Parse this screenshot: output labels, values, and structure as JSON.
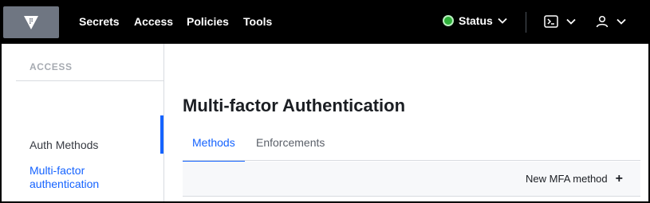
{
  "nav": {
    "links": [
      "Secrets",
      "Access",
      "Policies",
      "Tools"
    ],
    "status_label": "Status"
  },
  "sidebar": {
    "heading": "ACCESS",
    "items": [
      {
        "label": "Auth Methods"
      },
      {
        "label": "Multi-factor authentication"
      }
    ]
  },
  "main": {
    "title": "Multi-factor Authentication",
    "tabs": [
      {
        "label": "Methods"
      },
      {
        "label": "Enforcements"
      }
    ],
    "new_method_label": "New MFA method"
  },
  "colors": {
    "accent": "#1563ff",
    "status_ok": "#2eb039",
    "navbar": "#000000"
  }
}
